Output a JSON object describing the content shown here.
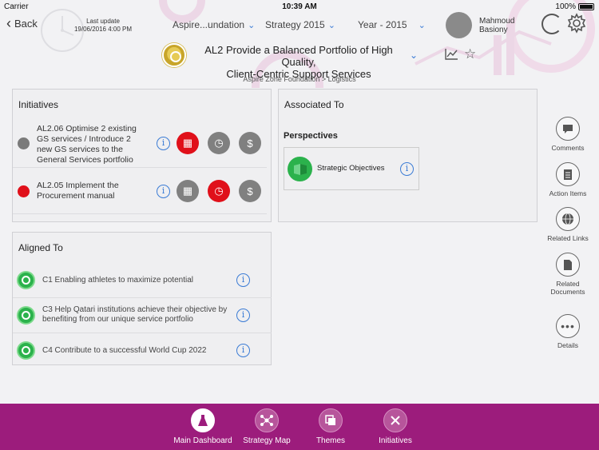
{
  "status_bar": {
    "carrier": "Carrier",
    "time": "10:39 AM",
    "battery": "100%"
  },
  "header": {
    "back_label": "Back",
    "last_update_label": "Last update",
    "last_update_value": "19/06/2016 4:00 PM",
    "organization_selector": "Aspire...undation",
    "strategy_selector": "Strategy 2015",
    "year_selector": "Year - 2015",
    "user_name_first": "Mahmoud",
    "user_name_last": "Basiony",
    "title_line1": "AL2 Provide a Balanced Portfolio of High Quality,",
    "title_line2": "Client-Centric Support Services",
    "breadcrumb": "Aspire Zone Foundation > Logistics"
  },
  "initiatives": {
    "title": "Initiatives",
    "items": [
      {
        "line1": "AL2.06 Optimise 2 existing",
        "line2": "GS services / Introduce 2",
        "line3": "new GS services to the",
        "line4": "General Services portfolio",
        "dot_color": "#7a7a7a",
        "status_colors": [
          "red",
          "grey",
          "grey"
        ]
      },
      {
        "line1": "AL2.05 Implement the",
        "line2": "Procurement manual",
        "dot_color": "#e0101a",
        "status_colors": [
          "grey",
          "red",
          "grey"
        ]
      }
    ]
  },
  "associated": {
    "title": "Associated To",
    "subtitle": "Perspectives",
    "card_label": "Strategic Objectives"
  },
  "aligned": {
    "title": "Aligned To",
    "items": [
      {
        "line1": "C1 Enabling athletes to maximize potential"
      },
      {
        "line1": "C3 Help Qatari institutions achieve their objective by",
        "line2": "benefiting from our unique service portfolio"
      },
      {
        "line1": "C4 Contribute to a successful World Cup 2022"
      }
    ]
  },
  "right_rail": {
    "comments": "Comments",
    "action_items": "Action Items",
    "related_links": "Related Links",
    "related_documents_1": "Related",
    "related_documents_2": "Documents",
    "details": "Details"
  },
  "tabbar": {
    "main_dashboard": "Main Dashboard",
    "strategy_map": "Strategy Map",
    "themes": "Themes",
    "initiatives": "Initiatives"
  },
  "colors": {
    "tabbar": "#9c1c7c",
    "accent_blue": "#3a7bd5",
    "status_red": "#e0101a",
    "status_grey": "#808080",
    "green": "#2bb24c"
  }
}
